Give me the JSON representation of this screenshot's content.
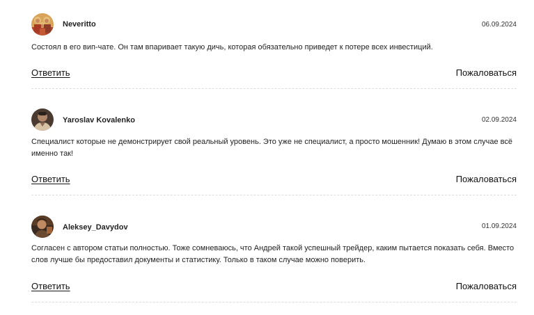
{
  "comments": [
    {
      "author": "Neveritto",
      "date": "06.09.2024",
      "text": "Состоял в его вип-чате. Он там впаривает такую дичь, которая обязательно приведет к потере всех инвестиций.",
      "reply_label": "Ответить",
      "report_label": "Пожаловаться",
      "avatar_icon": "icon-painting-avatar"
    },
    {
      "author": "Yaroslav Kovalenko",
      "date": "02.09.2024",
      "text": "Специалист которые не демонстрирует свой реальный уровень. Это уже не специалист, а просто мошенник! Думаю в этом случае всё именно так!",
      "reply_label": "Ответить",
      "report_label": "Пожаловаться",
      "avatar_icon": "user-photo-avatar"
    },
    {
      "author": "Aleksey_Davydov",
      "date": "01.09.2024",
      "text": "Согласен с автором статьи полностью. Тоже сомневаюсь, что Андрей такой успешный трейдер, каким пытается показать себя. Вместо слов лучше бы предоставил документы и статистику. Только в таком случае можно поверить.",
      "reply_label": "Ответить",
      "report_label": "Пожаловаться",
      "avatar_icon": "user-photo-avatar"
    }
  ]
}
